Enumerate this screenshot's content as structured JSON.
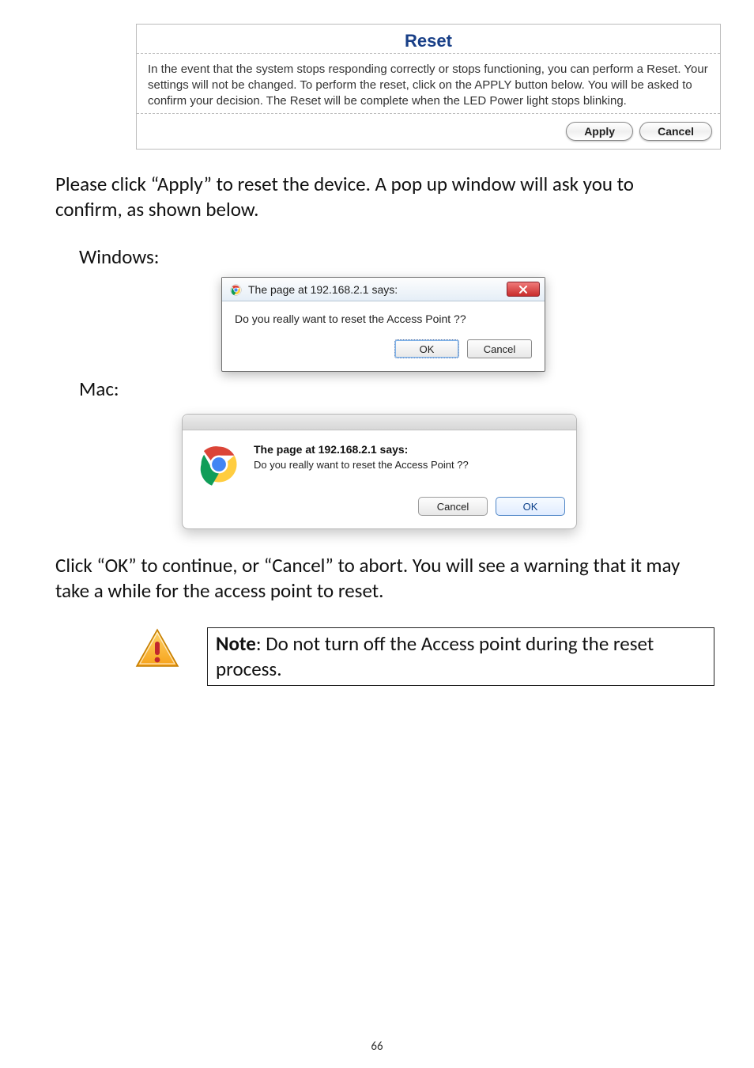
{
  "reset": {
    "title": "Reset",
    "body": "In the event that the system stops responding correctly or stops functioning, you can perform a Reset. Your settings will not be changed. To perform the reset, click on the APPLY button below. You will be asked to confirm your decision. The Reset will be complete when the LED Power light stops blinking.",
    "apply": "Apply",
    "cancel": "Cancel"
  },
  "instruction1": "Please click “Apply” to reset the device. A pop up window will ask you to confirm, as shown below.",
  "labels": {
    "windows": "Windows:",
    "mac": "Mac:"
  },
  "windows": {
    "title": "The page at 192.168.2.1 says:",
    "msg": "Do you really want to reset the Access Point ??",
    "ok": "OK",
    "cancel": "Cancel"
  },
  "mac": {
    "title": "The page at 192.168.2.1 says:",
    "msg": "Do you really want to reset the Access Point ??",
    "ok": "OK",
    "cancel": "Cancel"
  },
  "instruction2": "Click “OK” to continue, or “Cancel” to abort. You will see a warning that it may take a while for the access point to reset.",
  "note": {
    "lead": "Note",
    "text": ": Do not turn off the Access point during the reset process."
  },
  "page_number": "66"
}
